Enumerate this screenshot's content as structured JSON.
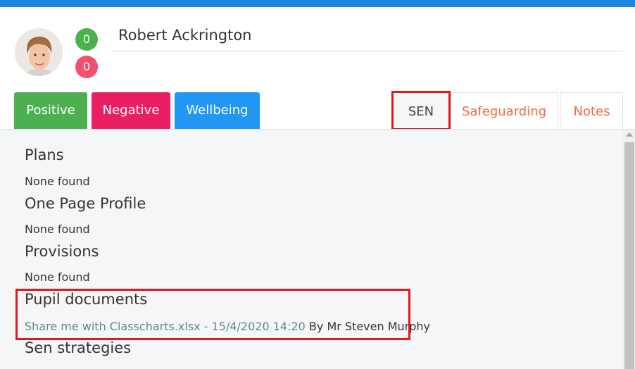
{
  "header": {
    "student_name": "Robert Ackrington",
    "positive_count": "0",
    "negative_count": "0"
  },
  "actions": {
    "positive_label": "Positive",
    "negative_label": "Negative",
    "wellbeing_label": "Wellbeing"
  },
  "tabs": [
    {
      "label": "SEN",
      "active": true
    },
    {
      "label": "Safeguarding",
      "active": false
    },
    {
      "label": "Notes",
      "active": false
    }
  ],
  "sen": {
    "plans": {
      "title": "Plans",
      "content": "None found"
    },
    "one_page_profile": {
      "title": "One Page Profile",
      "content": "None found"
    },
    "provisions": {
      "title": "Provisions",
      "content": "None found"
    },
    "pupil_documents": {
      "title": "Pupil documents",
      "documents": [
        {
          "link_text": "Share me with Classcharts.xlsx - 15/4/2020 14:20",
          "author": "By Mr Steven Murphy"
        }
      ]
    },
    "sen_strategies": {
      "title": "Sen strategies"
    }
  },
  "colors": {
    "top_bar": "#1f86e0",
    "positive": "#4caf50",
    "negative": "#e91e63",
    "negative_badge": "#f0506e",
    "wellbeing": "#2196f3",
    "tab_text": "#ef6c43",
    "highlight": "#e0191e"
  },
  "icons": {
    "avatar": "student-photo",
    "scroll_up": "scroll-up-arrow-icon"
  }
}
